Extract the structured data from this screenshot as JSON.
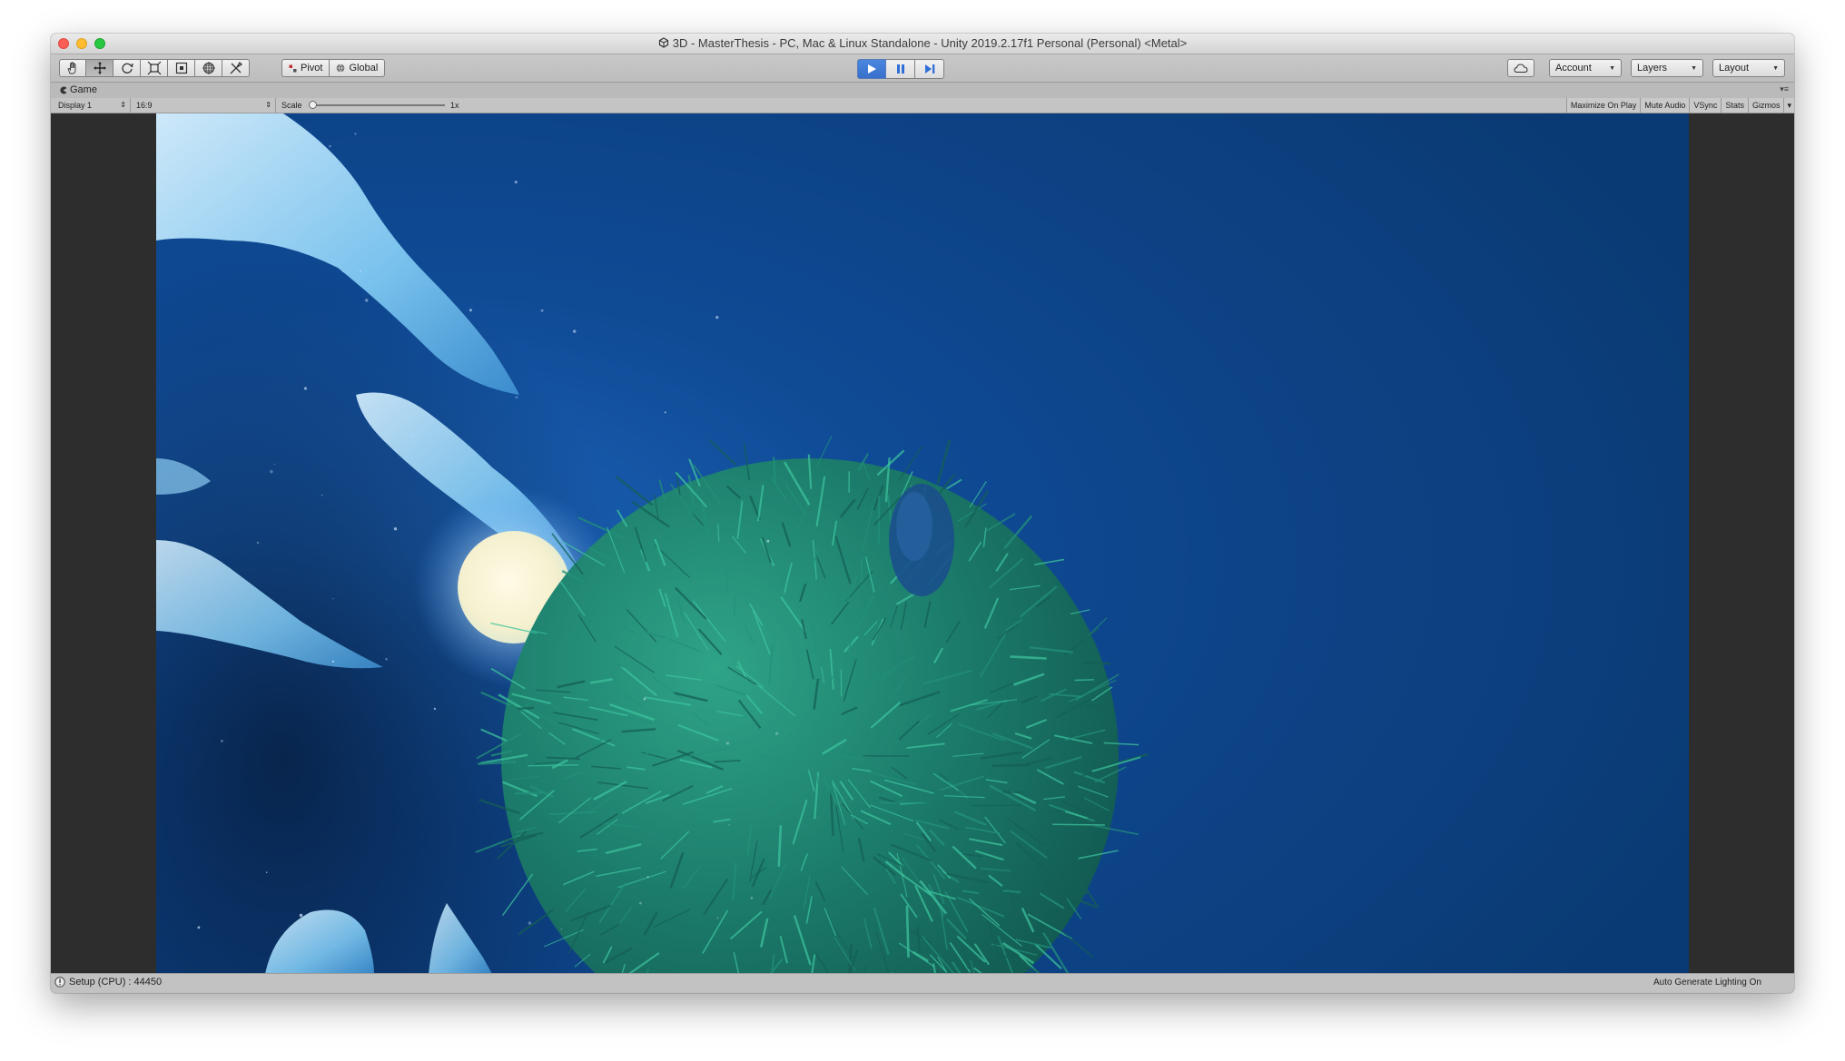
{
  "window": {
    "title": "3D - MasterThesis - PC, Mac & Linux Standalone - Unity 2019.2.17f1 Personal (Personal) <Metal>"
  },
  "toolbar": {
    "tools": [
      "hand-icon",
      "move-icon",
      "rotate-icon",
      "scale-icon",
      "rect-icon",
      "transform-icon",
      "custom-tool-icon"
    ],
    "pivot_label": "Pivot",
    "global_label": "Global",
    "account_label": "Account",
    "layers_label": "Layers",
    "layout_label": "Layout"
  },
  "game_tab": {
    "label": "Game"
  },
  "game_bar": {
    "display": "Display 1",
    "aspect": "16:9",
    "scale_label": "Scale",
    "scale_value": "1x",
    "scale_fraction": 0.0,
    "maximize_on_play": "Maximize On Play",
    "mute_audio": "Mute Audio",
    "vsync": "VSync",
    "stats": "Stats",
    "gizmos": "Gizmos"
  },
  "status": {
    "message": "Setup (CPU) : 44450",
    "lighting": "Auto Generate Lighting On"
  },
  "colors": {
    "play_active": "#3f7ad6",
    "sky": "#0b3a74",
    "grass": "#1f7a6a"
  }
}
